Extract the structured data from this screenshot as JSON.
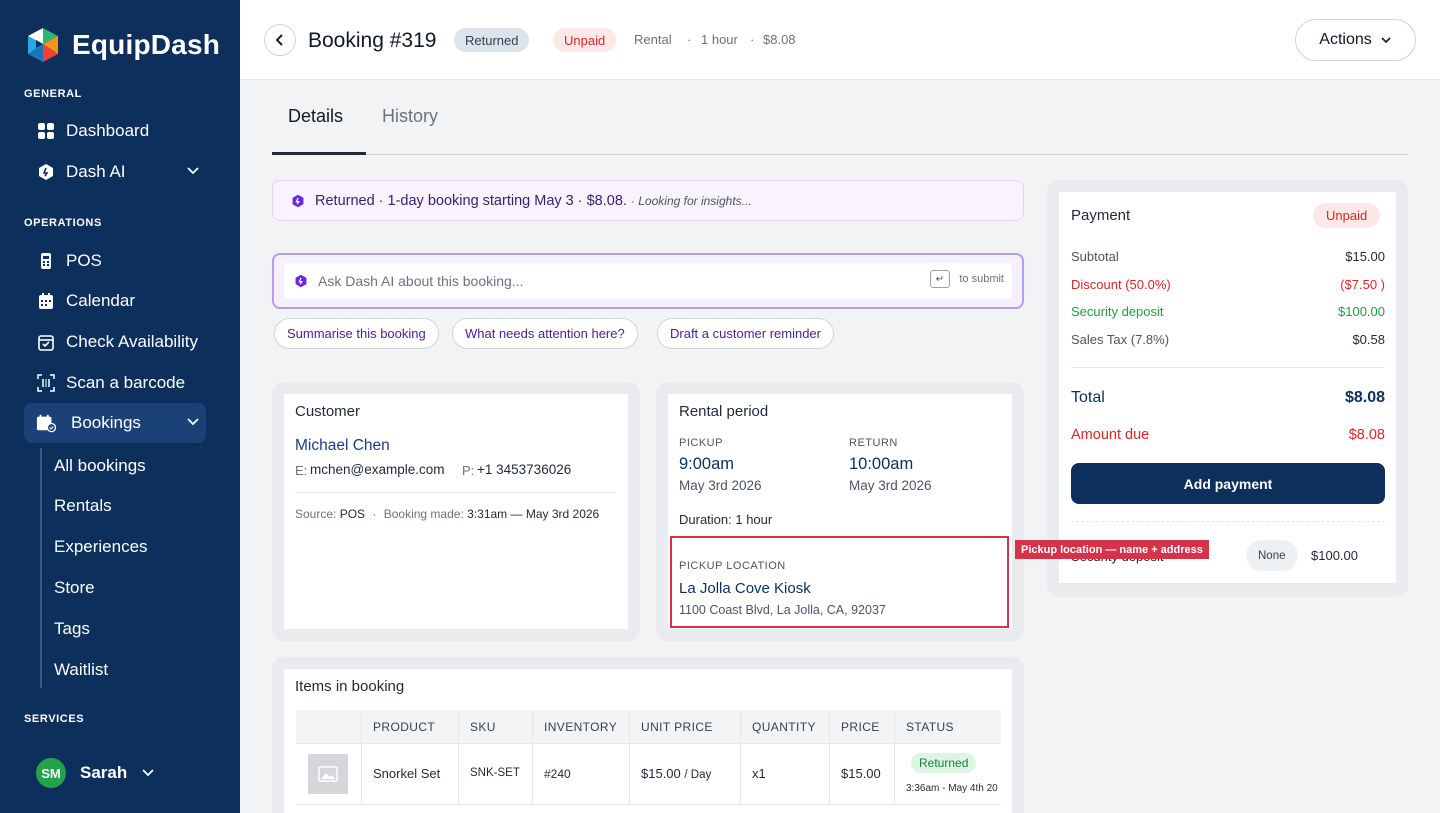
{
  "app": {
    "name": "EquipDash"
  },
  "sidebar": {
    "sections": {
      "general": "GENERAL",
      "operations": "OPERATIONS",
      "services": "SERVICES"
    },
    "items": {
      "dashboard": "Dashboard",
      "dash_ai": "Dash AI",
      "pos": "POS",
      "calendar": "Calendar",
      "check_availability": "Check Availability",
      "scan_barcode": "Scan a barcode",
      "bookings": "Bookings"
    },
    "bookings_sub": [
      "All bookings",
      "Rentals",
      "Experiences",
      "Store",
      "Tags",
      "Waitlist"
    ],
    "user": {
      "initials": "SM",
      "name": "Sarah"
    }
  },
  "header": {
    "title": "Booking #319",
    "status_badge": "Returned",
    "payment_badge": "Unpaid",
    "type": "Rental",
    "duration": "1 hour",
    "amount": "$8.08",
    "actions_label": "Actions"
  },
  "tabs": [
    "Details",
    "History"
  ],
  "insight": {
    "text": "Returned · 1-day booking starting May 3 · $8.08.",
    "loading": "· Looking for insights..."
  },
  "ask_ai": {
    "placeholder": "Ask Dash AI about this booking...",
    "enter_glyph": "↵",
    "submit_hint": "to submit",
    "suggestions": [
      "Summarise this booking",
      "What needs attention here?",
      "Draft a customer reminder"
    ]
  },
  "customer": {
    "title": "Customer",
    "name": "Michael Chen",
    "email_label": "E:",
    "email": "mchen@example.com",
    "phone_label": "P:",
    "phone": "+1 3453736026",
    "source_label": "Source:",
    "source": "POS",
    "made_label": "Booking made:",
    "made": "3:31am — May 3rd 2026"
  },
  "rental_period": {
    "title": "Rental period",
    "pickup_label": "PICKUP",
    "pickup_time": "9:00am",
    "pickup_date": "May 3rd 2026",
    "return_label": "RETURN",
    "return_time": "10:00am",
    "return_date": "May 3rd 2026",
    "duration": "Duration: 1 hour",
    "location_label": "PICKUP LOCATION",
    "location_name": "La Jolla Cove Kiosk",
    "location_address": "1100 Coast Blvd, La Jolla, CA, 92037"
  },
  "annotation": {
    "tag": "Pickup location — name + address"
  },
  "payment": {
    "title": "Payment",
    "badge": "Unpaid",
    "rows": [
      {
        "label": "Subtotal",
        "value": "$15.00"
      },
      {
        "label": "Discount (50.0%)",
        "value": "($7.50 )"
      },
      {
        "label": "Security deposit",
        "value": "$100.00"
      },
      {
        "label": "Sales Tax (7.8%)",
        "value": "$0.58"
      }
    ],
    "total_label": "Total",
    "total": "$8.08",
    "due_label": "Amount due",
    "due": "$8.08",
    "add_payment": "Add payment",
    "deposit_label": "Security deposit",
    "deposit_status": "None",
    "deposit_amount": "$100.00"
  },
  "items": {
    "title": "Items in booking",
    "columns": [
      "PRODUCT",
      "SKU",
      "INVENTORY",
      "UNIT PRICE",
      "QUANTITY",
      "PRICE",
      "STATUS"
    ],
    "rows": [
      {
        "product": "Snorkel Set",
        "sku": "SNK-SET",
        "inventory": "#240",
        "unit_price": "$15.00",
        "unit_suffix": "/ Day",
        "quantity": "x1",
        "price": "$15.00",
        "status": "Returned",
        "status_time": "3:36am - May 4th 20"
      }
    ]
  },
  "colors": {
    "sidebar": "#0d2f5c",
    "accent": "#0d2f5c",
    "danger": "#dc2626",
    "success": "#16a34a",
    "ai": "#6d28d9"
  }
}
